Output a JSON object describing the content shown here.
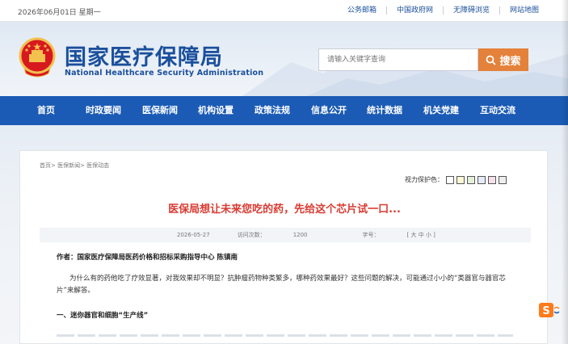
{
  "topbar": {
    "date": "2026年06月01日 星期一",
    "links": [
      "公务邮箱",
      "中国政府网",
      "无障碍浏览",
      "网站地图"
    ]
  },
  "header": {
    "title_cn": "国家医疗保障局",
    "title_en": "National Healthcare Security Administration",
    "search_placeholder": "请输入关键字查询",
    "search_label": "搜索"
  },
  "nav": {
    "items": [
      "首页",
      "时政要闻",
      "医保新闻",
      "机构设置",
      "政策法规",
      "信息公开",
      "统计数据",
      "机关党建",
      "互动交流"
    ]
  },
  "article": {
    "breadcrumb": "首页> 医保新闻> 医保动态",
    "vision_label": "视力保护色：",
    "vision_colors": [
      "#ffffff",
      "#fcf8d6",
      "#e3f1d9",
      "#e6ecf8",
      "#f5e1ea",
      "#eeeeee"
    ],
    "title": "医保局想让未来您吃的药，先给这个芯片试一口...",
    "date": "2026-05-27",
    "visits_label": "访问次数：",
    "visits": "1200",
    "font_size_label": "字号：",
    "font_sizes": "[ 大 中 小 ]",
    "author": "作者：国家医疗保障局医药价格和招标采购指导中心 陈镇南",
    "intro": "为什么有的药他吃了疗效显著，对我效果却不明显？抗肿瘤药物种类繁多，哪种药效果最好？这些问题的解决，可能通过小小的“类器官与器官芯片”来解答。",
    "section1": "一、迷你器官和细胞“生产线”"
  },
  "colors": {
    "nav_bg": "#1b5bb5",
    "brand_blue": "#1a4f9c",
    "title_red": "#d83b32",
    "search_orange": "#e4813a"
  },
  "icons": {
    "emblem": "national-emblem-icon",
    "search": "search-icon",
    "float": "sogou-s-icon"
  }
}
